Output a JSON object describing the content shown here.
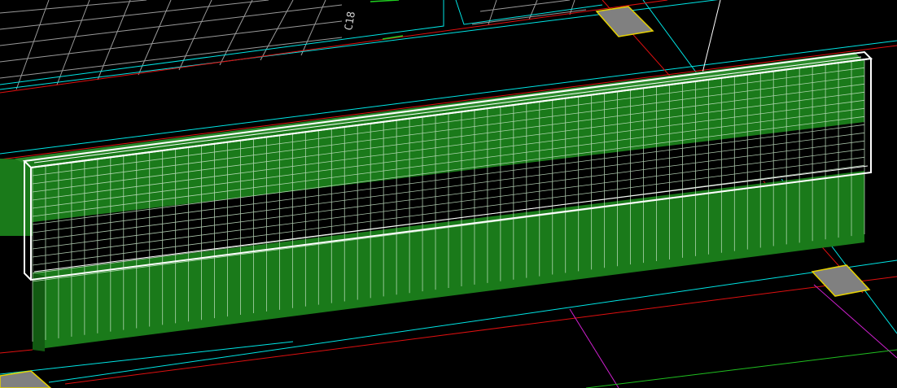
{
  "viewport": {
    "background": "#000000",
    "grid_label": "C18"
  },
  "colors": {
    "slab_grid": "#9a9a9a",
    "cyan_line": "#00e5e5",
    "red_line": "#e01010",
    "magenta_line": "#d020d0",
    "green_line": "#20c020",
    "wall_green": "#1a7a1a",
    "wall_green_dark": "#125a12",
    "wall_top": "#2a8a2a",
    "rebar": "#c8e6c8",
    "selection": "#ffffff",
    "column_pad": "#808080",
    "column_pad_edge": "#e6d200"
  },
  "selection": {
    "state": "selected"
  }
}
